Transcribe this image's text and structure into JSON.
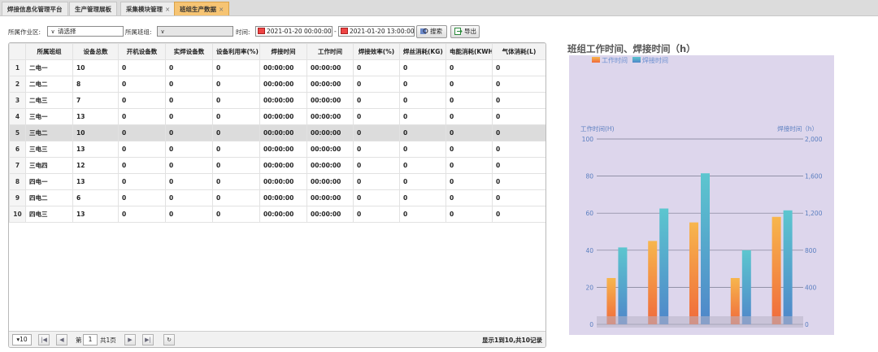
{
  "tabs": [
    {
      "label": "焊接信息化管理平台",
      "closable": false,
      "active": false
    },
    {
      "label": "生产管理展板",
      "closable": false,
      "active": false
    },
    {
      "label": "采集模块管理",
      "closable": true,
      "active": false
    },
    {
      "label": "班组生产数据",
      "closable": true,
      "active": true
    }
  ],
  "tab_close_glyph": "×",
  "filters": {
    "area_label": "所属作业区:",
    "area_value": "请选择",
    "team_label": "所属班组:",
    "team_value": "",
    "time_label": "时间:",
    "start_time": "2021-01-20 00:00:00",
    "end_time": "2021-01-20 13:00:00",
    "range_sep": "-",
    "search_label": "搜索",
    "export_label": "导出"
  },
  "table": {
    "columns": [
      "",
      "所属班组",
      "设备总数",
      "开机设备数",
      "实焊设备数",
      "设备利用率(%)",
      "焊接时间",
      "工作时间",
      "焊接效率(%)",
      "焊丝消耗(KG)",
      "电能消耗(KWH)",
      "气体消耗(L)"
    ],
    "rows": [
      [
        "1",
        "二电一",
        "10",
        "0",
        "0",
        "0",
        "00:00:00",
        "00:00:00",
        "0",
        "0",
        "0",
        "0"
      ],
      [
        "2",
        "二电二",
        "8",
        "0",
        "0",
        "0",
        "00:00:00",
        "00:00:00",
        "0",
        "0",
        "0",
        "0"
      ],
      [
        "3",
        "二电三",
        "7",
        "0",
        "0",
        "0",
        "00:00:00",
        "00:00:00",
        "0",
        "0",
        "0",
        "0"
      ],
      [
        "4",
        "三电一",
        "13",
        "0",
        "0",
        "0",
        "00:00:00",
        "00:00:00",
        "0",
        "0",
        "0",
        "0"
      ],
      [
        "5",
        "三电二",
        "10",
        "0",
        "0",
        "0",
        "00:00:00",
        "00:00:00",
        "0",
        "0",
        "0",
        "0"
      ],
      [
        "6",
        "三电三",
        "13",
        "0",
        "0",
        "0",
        "00:00:00",
        "00:00:00",
        "0",
        "0",
        "0",
        "0"
      ],
      [
        "7",
        "三电四",
        "12",
        "0",
        "0",
        "0",
        "00:00:00",
        "00:00:00",
        "0",
        "0",
        "0",
        "0"
      ],
      [
        "8",
        "四电一",
        "13",
        "0",
        "0",
        "0",
        "00:00:00",
        "00:00:00",
        "0",
        "0",
        "0",
        "0"
      ],
      [
        "9",
        "四电二",
        "6",
        "0",
        "0",
        "0",
        "00:00:00",
        "00:00:00",
        "0",
        "0",
        "0",
        "0"
      ],
      [
        "10",
        "四电三",
        "13",
        "0",
        "0",
        "0",
        "00:00:00",
        "00:00:00",
        "0",
        "0",
        "0",
        "0"
      ]
    ],
    "selected_row": 4
  },
  "pager": {
    "page_size": "10",
    "page_prefix": "第",
    "page_value": "1",
    "page_suffix": "共1页",
    "summary": "显示1到10,共10记录",
    "first_glyph": "|◀",
    "prev_glyph": "◀",
    "next_glyph": "▶",
    "last_glyph": "▶|",
    "refresh_glyph": "↻",
    "size_glyph": "▾"
  },
  "chart_title": "班组工作时间、焊接时间（h）",
  "chart_data": {
    "type": "bar",
    "legend": [
      "工作时间",
      "焊接时间"
    ],
    "legend_position": "top-left",
    "y_left_label": "工作时间(H)",
    "y_right_label": "焊接时间（h）",
    "y_left_ticks": [
      "0",
      "20",
      "40",
      "60",
      "80",
      "100"
    ],
    "y_right_ticks": [
      "0",
      "400",
      "800",
      "1,200",
      "1,600",
      "2,000"
    ],
    "y_left_range": [
      0,
      100
    ],
    "y_right_range": [
      0,
      2000
    ],
    "categories": [
      "",
      "",
      "",
      "",
      ""
    ],
    "series": [
      {
        "name": "工作时间",
        "axis": "left",
        "values": [
          25,
          45,
          55,
          25,
          58
        ],
        "color_top": "#f7b64d",
        "color_bottom": "#f06a3b"
      },
      {
        "name": "焊接时间",
        "axis": "right",
        "values": [
          830,
          1250,
          1630,
          800,
          1230
        ],
        "color_top": "#5cc6cf",
        "color_bottom": "#4f86c9"
      }
    ],
    "grid": true,
    "background": "#ddd6ec"
  }
}
